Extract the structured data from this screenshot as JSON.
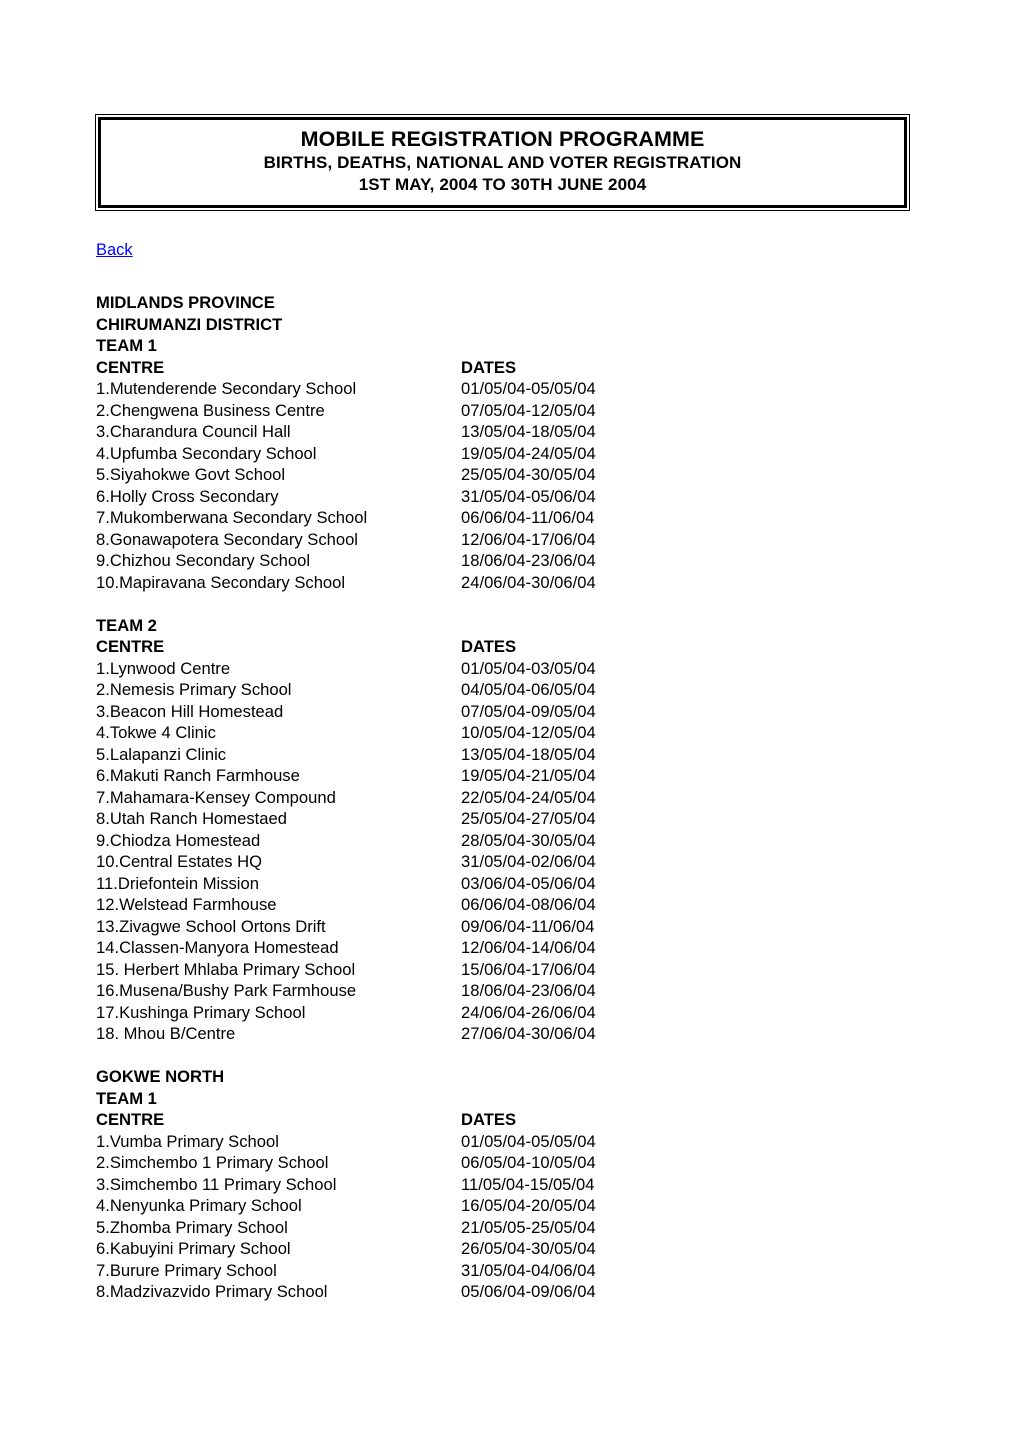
{
  "header": {
    "line1": "MOBILE REGISTRATION PROGRAMME",
    "line2": "BIRTHS, DEATHS, NATIONAL AND VOTER REGISTRATION",
    "line3": "1ST MAY, 2004 TO 30TH JUNE 2004"
  },
  "nav": {
    "back_label": "Back",
    "link_color": "#0000FF"
  },
  "province": "MIDLANDS PROVINCE",
  "columns": {
    "centre": "CENTRE",
    "dates": "DATES"
  },
  "sections": [
    {
      "district": "CHIRUMANZI DISTRICT",
      "teams": [
        {
          "team": "TEAM 1",
          "rows": [
            {
              "centre": "1.Mutenderende Secondary School",
              "dates": "01/05/04-05/05/04"
            },
            {
              "centre": "2.Chengwena Business Centre",
              "dates": "07/05/04-12/05/04"
            },
            {
              "centre": "3.Charandura Council Hall",
              "dates": "13/05/04-18/05/04"
            },
            {
              "centre": "4.Upfumba Secondary School",
              "dates": "19/05/04-24/05/04"
            },
            {
              "centre": "5.Siyahokwe Govt School",
              "dates": "25/05/04-30/05/04"
            },
            {
              "centre": "6.Holly Cross Secondary",
              "dates": "31/05/04-05/06/04"
            },
            {
              "centre": "7.Mukomberwana Secondary School",
              "dates": "06/06/04-11/06/04"
            },
            {
              "centre": "8.Gonawapotera Secondary School",
              "dates": "12/06/04-17/06/04"
            },
            {
              "centre": "9.Chizhou Secondary School",
              "dates": "18/06/04-23/06/04"
            },
            {
              "centre": "10.Mapiravana Secondary School",
              "dates": "24/06/04-30/06/04"
            }
          ]
        },
        {
          "team": "TEAM 2",
          "rows": [
            {
              "centre": "1.Lynwood Centre",
              "dates": "01/05/04-03/05/04"
            },
            {
              "centre": "2.Nemesis Primary School",
              "dates": "04/05/04-06/05/04"
            },
            {
              "centre": "3.Beacon Hill Homestead",
              "dates": "07/05/04-09/05/04"
            },
            {
              "centre": "4.Tokwe 4 Clinic",
              "dates": "10/05/04-12/05/04"
            },
            {
              "centre": "5.Lalapanzi Clinic",
              "dates": "13/05/04-18/05/04"
            },
            {
              "centre": "6.Makuti Ranch Farmhouse",
              "dates": "19/05/04-21/05/04"
            },
            {
              "centre": "7.Mahamara-Kensey Compound",
              "dates": "22/05/04-24/05/04"
            },
            {
              "centre": "8.Utah Ranch Homestaed",
              "dates": "25/05/04-27/05/04"
            },
            {
              "centre": "9.Chiodza Homestead",
              "dates": "28/05/04-30/05/04"
            },
            {
              "centre": "10.Central Estates HQ",
              "dates": "31/05/04-02/06/04"
            },
            {
              "centre": "11.Driefontein Mission",
              "dates": "03/06/04-05/06/04"
            },
            {
              "centre": "12.Welstead Farmhouse",
              "dates": "06/06/04-08/06/04"
            },
            {
              "centre": "13.Zivagwe School Ortons Drift",
              "dates": "09/06/04-11/06/04"
            },
            {
              "centre": "14.Classen-Manyora Homestead",
              "dates": "12/06/04-14/06/04"
            },
            {
              "centre": "15. Herbert Mhlaba Primary School",
              "dates": "15/06/04-17/06/04"
            },
            {
              "centre": "16.Musena/Bushy Park Farmhouse",
              "dates": "18/06/04-23/06/04"
            },
            {
              "centre": "17.Kushinga Primary School",
              "dates": "24/06/04-26/06/04"
            },
            {
              "centre": "18. Mhou B/Centre",
              "dates": "27/06/04-30/06/04"
            }
          ]
        }
      ]
    },
    {
      "district": "GOKWE NORTH",
      "teams": [
        {
          "team": "TEAM 1",
          "rows": [
            {
              "centre": "1.Vumba Primary School",
              "dates": "01/05/04-05/05/04"
            },
            {
              "centre": "2.Simchembo 1 Primary School",
              "dates": "06/05/04-10/05/04"
            },
            {
              "centre": "3.Simchembo 11 Primary School",
              "dates": "11/05/04-15/05/04"
            },
            {
              "centre": "4.Nenyunka Primary School",
              "dates": "16/05/04-20/05/04"
            },
            {
              "centre": "5.Zhomba Primary School",
              "dates": "21/05/05-25/05/04"
            },
            {
              "centre": "6.Kabuyini Primary School",
              "dates": "26/05/04-30/05/04"
            },
            {
              "centre": "7.Burure Primary School",
              "dates": "31/05/04-04/06/04"
            },
            {
              "centre": "8.Madzivazvido Primary School",
              "dates": "05/06/04-09/06/04"
            }
          ]
        }
      ]
    }
  ]
}
